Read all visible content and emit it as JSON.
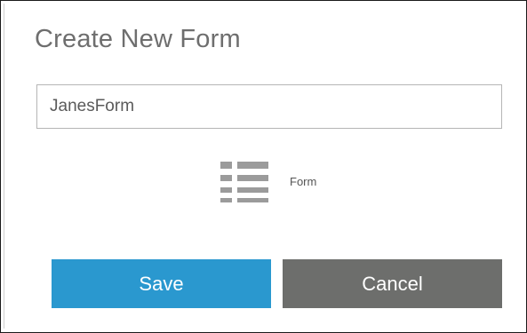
{
  "dialog": {
    "title": "Create New Form",
    "name_input": {
      "value": "JanesForm",
      "placeholder": ""
    },
    "form_type": {
      "icon": "list-icon",
      "label": "Form"
    },
    "buttons": {
      "save_label": "Save",
      "cancel_label": "Cancel"
    }
  },
  "colors": {
    "save_button": "#2a98cf",
    "cancel_button": "#6d6e6c",
    "title_text": "#6e6e6e",
    "icon": "#9b9b9b"
  }
}
